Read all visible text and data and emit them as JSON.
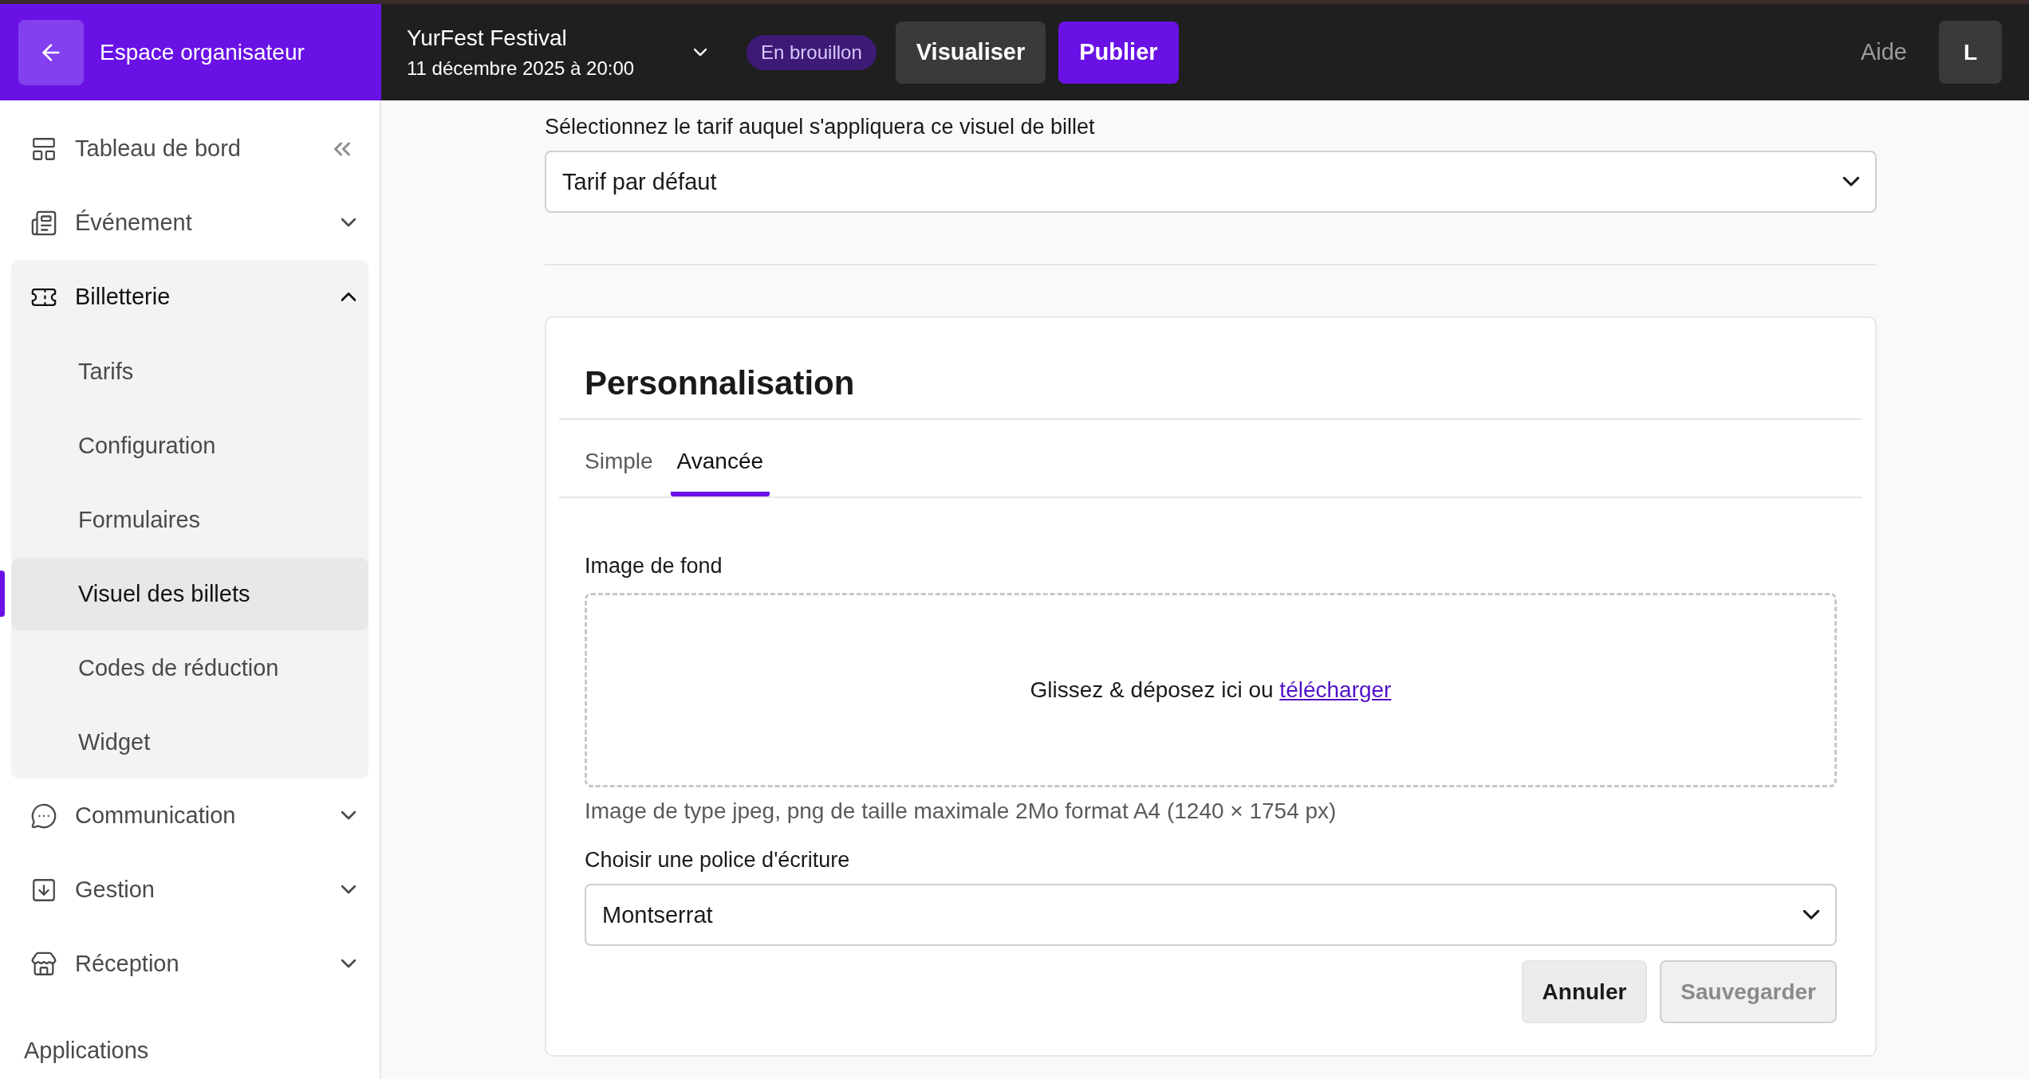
{
  "header": {
    "back_label": "Espace organisateur",
    "event": {
      "title": "YurFest Festival",
      "date": "11 décembre 2025 à 20:00"
    },
    "status_badge": "En brouillon",
    "buttons": [
      {
        "label": "Visualiser",
        "kind": "secondary"
      },
      {
        "label": "Publier",
        "kind": "primary"
      }
    ],
    "help": "Aide",
    "avatar": "L"
  },
  "sidebar": {
    "items": [
      {
        "label": "Tableau de bord",
        "kind": "link"
      },
      {
        "label": "Événement",
        "kind": "group",
        "expanded": false
      },
      {
        "label": "Billetterie",
        "kind": "group",
        "expanded": true,
        "children": [
          {
            "label": "Tarifs",
            "selected": false
          },
          {
            "label": "Configuration",
            "selected": false
          },
          {
            "label": "Formulaires",
            "selected": false
          },
          {
            "label": "Visuel des billets",
            "selected": true
          },
          {
            "label": "Codes de réduction",
            "selected": false
          },
          {
            "label": "Widget",
            "selected": false
          }
        ]
      },
      {
        "label": "Communication",
        "kind": "group",
        "expanded": false
      },
      {
        "label": "Gestion",
        "kind": "group",
        "expanded": false
      },
      {
        "label": "Réception",
        "kind": "group",
        "expanded": false
      }
    ],
    "section": "Applications"
  },
  "main": {
    "tarif_label": "Sélectionnez le tarif auquel s'appliquera ce visuel de billet",
    "tarif_select": "Tarif par défaut",
    "card": {
      "title": "Personnalisation",
      "tabs": [
        {
          "label": "Simple",
          "selected": false
        },
        {
          "label": "Avancée",
          "selected": true
        }
      ],
      "image_label": "Image de fond",
      "dropzone": {
        "text": "Glissez & déposez ici ou",
        "link": "télécharger"
      },
      "hint": "Image de type jpeg, png de taille maximale 2Mo format A4 (1240 × 1754 px)",
      "font_label": "Choisir une police d'écriture",
      "font_select": "Montserrat",
      "buttons": [
        {
          "label": "Annuler",
          "disabled": false
        },
        {
          "label": "Sauvegarder",
          "disabled": true
        }
      ]
    }
  }
}
